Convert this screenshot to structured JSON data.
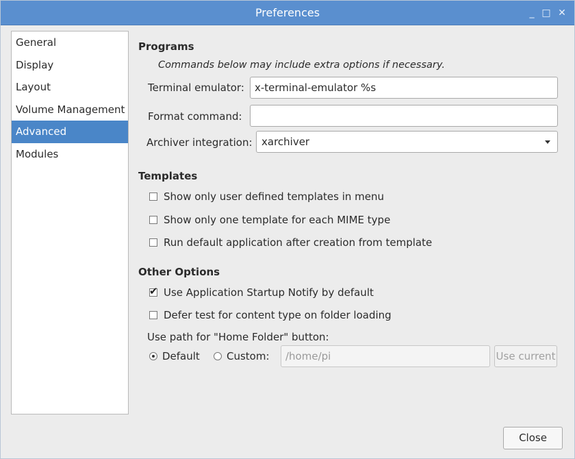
{
  "window": {
    "title": "Preferences",
    "controls": {
      "minimize": "_",
      "maximize": "□",
      "close": "✕"
    },
    "title_bar_color": "#5a8fcf"
  },
  "sidebar": {
    "items": [
      {
        "label": "General",
        "selected": false
      },
      {
        "label": "Display",
        "selected": false
      },
      {
        "label": "Layout",
        "selected": false
      },
      {
        "label": "Volume Management",
        "selected": false
      },
      {
        "label": "Advanced",
        "selected": true
      },
      {
        "label": "Modules",
        "selected": false
      }
    ],
    "selected_color": "#4a86c8"
  },
  "programs": {
    "heading": "Programs",
    "note": "Commands below may include extra options if necessary.",
    "terminal_label": "Terminal emulator:",
    "terminal_value": "x-terminal-emulator %s",
    "format_label": "Format command:",
    "format_value": "",
    "archiver_label": "Archiver integration:",
    "archiver_value": "xarchiver"
  },
  "templates": {
    "heading": "Templates",
    "options": [
      {
        "label": "Show only user defined templates in menu",
        "checked": false
      },
      {
        "label": "Show only one template for each MIME type",
        "checked": false
      },
      {
        "label": "Run default application after creation from template",
        "checked": false
      }
    ]
  },
  "other": {
    "heading": "Other Options",
    "options": [
      {
        "label": "Use Application Startup Notify by default",
        "checked": true
      },
      {
        "label": "Defer test for content type on folder loading",
        "checked": false
      }
    ],
    "home_label": "Use path for \"Home Folder\" button:",
    "radio_default": "Default",
    "radio_custom": "Custom:",
    "selected_radio": "Default",
    "custom_path": "/home/pi",
    "use_current": "Use current"
  },
  "footer": {
    "close": "Close"
  },
  "icons": {
    "checkbox_checked": "✔"
  }
}
